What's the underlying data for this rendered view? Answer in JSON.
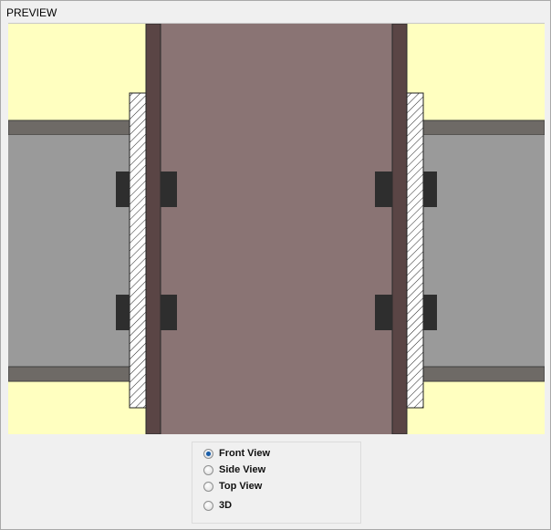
{
  "panel": {
    "title": "PREVIEW"
  },
  "colors": {
    "background_fill": "#ffffc0",
    "column_web": "#8a7474",
    "column_flange": "#5a4545",
    "beam_web": "#9a9a9a",
    "beam_flange": "#6e6a66",
    "bolt": "#2e2e2e",
    "plate_hatch": "#222222",
    "selected_radio": "#1a5ea8"
  },
  "view_options": {
    "items": [
      {
        "label": "Front View",
        "checked": true
      },
      {
        "label": "Side View",
        "checked": false
      },
      {
        "label": "Top View",
        "checked": false
      },
      {
        "label": "3D",
        "checked": false
      }
    ]
  }
}
